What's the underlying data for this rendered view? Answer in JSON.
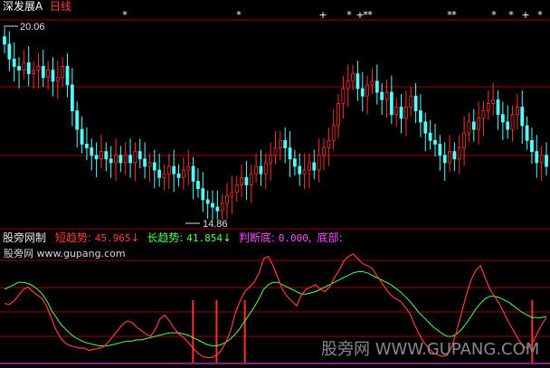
{
  "header": {
    "stock_name": "深发展A",
    "period": "日线",
    "stock_color": "#ffffff",
    "period_color": "#ff4040"
  },
  "price_panel": {
    "high_label": "20.06",
    "low_label": "14.86",
    "marker_glyphs": [
      "*",
      "*",
      "+",
      "*",
      "+",
      "*",
      "*",
      "*",
      "*",
      "*",
      "*",
      "+",
      "*"
    ],
    "grid_color": "#a00000",
    "up_color": "#ff3030",
    "down_color": "#54ffff"
  },
  "indicator_panel": {
    "title": "股旁网制",
    "title_color": "#e8e8e8",
    "watermark_small": "股旁网 www.gupang.com",
    "items": [
      {
        "name": "短趋势",
        "value": "45.965",
        "arrow": "↓",
        "color": "#ff3b3b"
      },
      {
        "name": "长趋势",
        "value": "41.854",
        "arrow": "↓",
        "color": "#54ff54"
      },
      {
        "name": "判断底",
        "value": "0.000",
        "color": "#ff4dff"
      },
      {
        "name": "底部",
        "value": "",
        "color": "#ff4dff"
      }
    ]
  },
  "watermark": "股旁网 WWW.GUPANG.COM",
  "chart_data": {
    "type": "line",
    "price": {
      "high": 20.06,
      "low": 14.86,
      "closes": [
        19.6,
        19.2,
        19.0,
        18.9,
        19.1,
        18.8,
        18.9,
        19.0,
        18.7,
        18.9,
        18.6,
        18.7,
        19.0,
        18.5,
        17.8,
        17.3,
        16.9,
        16.8,
        16.6,
        16.5,
        16.7,
        16.5,
        16.4,
        16.6,
        16.4,
        16.6,
        16.4,
        16.7,
        16.5,
        16.3,
        16.4,
        16.2,
        16.0,
        16.1,
        16.3,
        16.1,
        16.0,
        16.2,
        16.3,
        15.9,
        15.7,
        15.4,
        15.3,
        15.2,
        15.1,
        15.3,
        15.5,
        15.6,
        15.8,
        16.0,
        15.8,
        16.1,
        16.3,
        16.1,
        16.4,
        16.6,
        16.8,
        17.0,
        16.8,
        16.5,
        16.3,
        16.1,
        16.2,
        16.4,
        16.2,
        16.6,
        16.8,
        17.0,
        17.4,
        18.0,
        18.4,
        18.6,
        18.8,
        18.4,
        18.2,
        18.5,
        18.6,
        18.3,
        18.1,
        18.3,
        17.7,
        17.9,
        17.6,
        17.9,
        18.2,
        17.8,
        17.5,
        17.2,
        17.0,
        16.9,
        16.6,
        16.4,
        16.7,
        16.5,
        16.8,
        17.2,
        17.5,
        17.3,
        17.6,
        17.8,
        18.0,
        18.1,
        17.7,
        17.5,
        17.3,
        17.7,
        17.9,
        17.4,
        17.0,
        16.7,
        16.4,
        16.6,
        16.3
      ]
    },
    "series": [
      {
        "name": "短趋势",
        "color": "#ff3b3b",
        "values": [
          48,
          47,
          50,
          55,
          60,
          62,
          58,
          55,
          52,
          45,
          35,
          25,
          18,
          14,
          12,
          11,
          10,
          10,
          8,
          9,
          10,
          11,
          15,
          20,
          25,
          30,
          33,
          32,
          28,
          25,
          22,
          20,
          26,
          35,
          38,
          33,
          27,
          22,
          19,
          15,
          10,
          6,
          3,
          2,
          2,
          4,
          8,
          15,
          25,
          40,
          50,
          58,
          62,
          66,
          74,
          86,
          88,
          80,
          70,
          60,
          54,
          50,
          46,
          55,
          60,
          62,
          64,
          60,
          58,
          62,
          70,
          76,
          84,
          88,
          90,
          86,
          82,
          80,
          78,
          72,
          66,
          60,
          55,
          52,
          50,
          45,
          40,
          30,
          22,
          15,
          10,
          6,
          4,
          3,
          4,
          12,
          25,
          40,
          55,
          68,
          76,
          80,
          70,
          60,
          54,
          48,
          40,
          32,
          25,
          18,
          12,
          10,
          14,
          22,
          30,
          36
        ]
      },
      {
        "name": "长趋势",
        "color": "#54ff54",
        "values": [
          60,
          62,
          64,
          66,
          66,
          65,
          63,
          60,
          56,
          50,
          42,
          36,
          30,
          26,
          22,
          19,
          17,
          15,
          14,
          13,
          12,
          12,
          12,
          13,
          14,
          15,
          16,
          16,
          17,
          17,
          18,
          19,
          20,
          21,
          22,
          23,
          23,
          23,
          22,
          21,
          19,
          17,
          15,
          13,
          12,
          12,
          13,
          15,
          18,
          22,
          27,
          33,
          39,
          45,
          52,
          60,
          64,
          66,
          66,
          64,
          62,
          60,
          58,
          56,
          56,
          57,
          58,
          60,
          62,
          64,
          66,
          68,
          70,
          72,
          74,
          75,
          75,
          74,
          72,
          70,
          68,
          66,
          64,
          61,
          58,
          54,
          50,
          45,
          40,
          36,
          32,
          28,
          25,
          22,
          20,
          20,
          22,
          26,
          31,
          37,
          43,
          48,
          52,
          54,
          54,
          53,
          51,
          49,
          46,
          43,
          40,
          38,
          36,
          36,
          36,
          37
        ]
      },
      {
        "name": "判断底",
        "color": "#ff3b3b",
        "bottom_signals_at": [
          40,
          45,
          51,
          112
        ]
      }
    ]
  }
}
